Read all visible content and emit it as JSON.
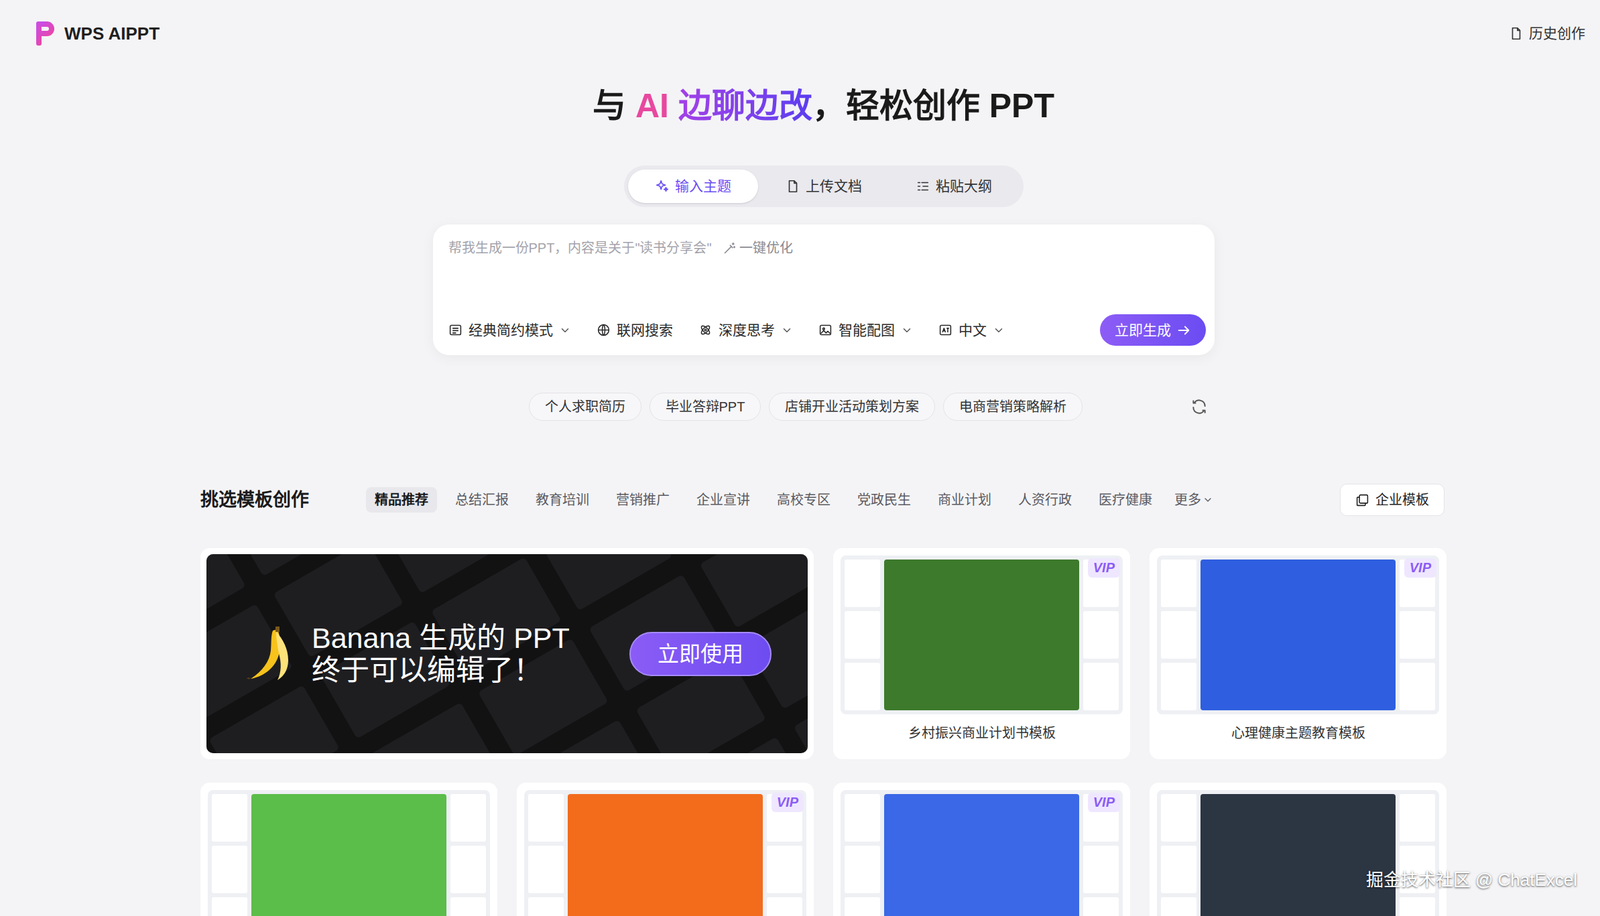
{
  "header": {
    "logo": "WPS AIPPT",
    "history": "历史创作"
  },
  "hero": {
    "parts": [
      {
        "text": "与 ",
        "kind": "plain"
      },
      {
        "text": "AI",
        "kind": "pink"
      },
      {
        "text": " 边聊边改",
        "kind": "gradient"
      },
      {
        "text": "，轻松创作 PPT",
        "kind": "plain"
      }
    ]
  },
  "input_tabs": [
    {
      "label": "输入主题",
      "selected": true
    },
    {
      "label": "上传文档",
      "selected": false
    },
    {
      "label": "粘贴大纲",
      "selected": false
    }
  ],
  "prompt": {
    "placeholder": "帮我生成一份PPT，内容是关于\"读书分享会\"",
    "optimize": "一键优化"
  },
  "options": [
    {
      "label": "经典简约模式",
      "dropdown": true
    },
    {
      "label": "联网搜索",
      "dropdown": false
    },
    {
      "label": "深度思考",
      "dropdown": true
    },
    {
      "label": "智能配图",
      "dropdown": true
    },
    {
      "label": "中文",
      "dropdown": true
    }
  ],
  "generate_button": "立即生成",
  "suggestions": [
    "个人求职简历",
    "毕业答辩PPT",
    "店铺开业活动策划方案",
    "电商营销策略解析"
  ],
  "templates": {
    "heading": "挑选模板创作",
    "categories": [
      {
        "label": "精品推荐",
        "selected": true
      },
      {
        "label": "总结汇报",
        "selected": false
      },
      {
        "label": "教育培训",
        "selected": false
      },
      {
        "label": "营销推广",
        "selected": false
      },
      {
        "label": "企业宣讲",
        "selected": false
      },
      {
        "label": "高校专区",
        "selected": false
      },
      {
        "label": "党政民生",
        "selected": false
      },
      {
        "label": "商业计划",
        "selected": false
      },
      {
        "label": "人资行政",
        "selected": false
      },
      {
        "label": "医疗健康",
        "selected": false
      }
    ],
    "more": "更多",
    "enterprise": "企业模板",
    "vip_label": "VIP",
    "banner": {
      "line1": "Banana 生成的 PPT",
      "line2": "终于可以编辑了！",
      "button": "立即使用"
    },
    "cards": [
      {
        "title": "乡村振兴商业计划书模板",
        "vip": true,
        "color": "#3d7a2c"
      },
      {
        "title": "心理健康主题教育模板",
        "vip": true,
        "color": "#2f5fe0"
      },
      {
        "title": "",
        "vip": false,
        "color": "#5bbd4a"
      },
      {
        "title": "",
        "vip": true,
        "color": "#f26c1c"
      },
      {
        "title": "",
        "vip": true,
        "color": "#3a68e6"
      },
      {
        "title": "",
        "vip": false,
        "color": "#2c3542"
      }
    ]
  },
  "watermark": "掘金技术社区 @ ChatExcel"
}
